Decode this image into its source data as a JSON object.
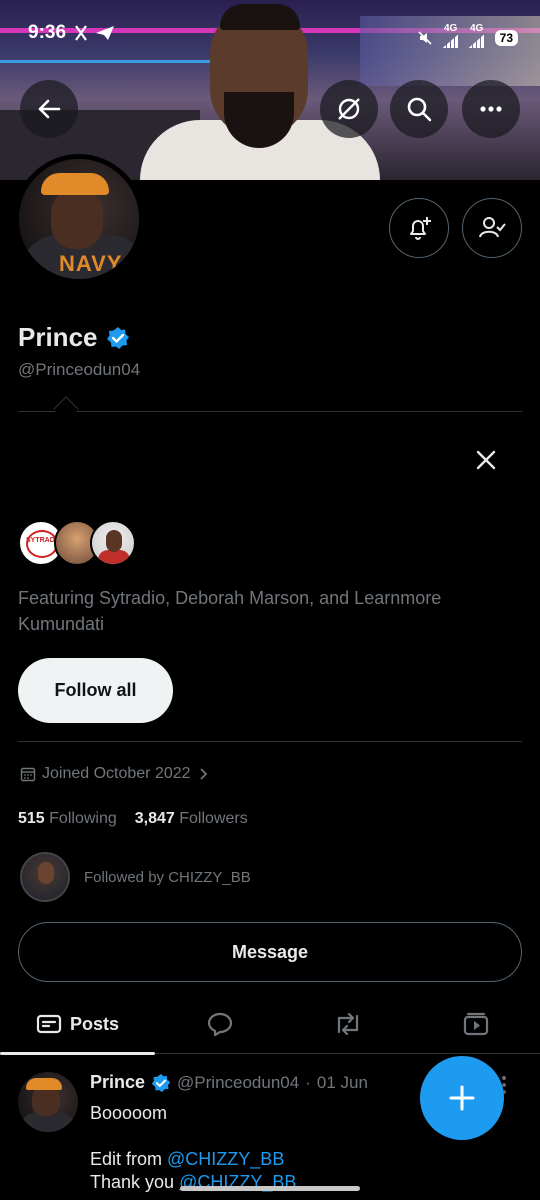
{
  "status_bar": {
    "time": "9:36",
    "network1": "4G",
    "network2": "4G",
    "battery": "73"
  },
  "banner_icons": {
    "back": "arrow-left-icon",
    "grok": "grok-icon",
    "search": "search-icon",
    "more": "more-horizontal-icon"
  },
  "profile": {
    "name": "Prince",
    "handle": "@Princeodun04",
    "joined": "Joined October 2022",
    "following_count": "515",
    "following_label": "Following",
    "followers_count": "3,847",
    "followers_label": "Followers",
    "followed_by": "Followed by CHIZZY_BB",
    "avatar_text": "NAVY"
  },
  "suggestions": {
    "featuring": "Featuring Sytradio, Deborah Marson, and Learnmore Kumundati",
    "follow_all_label": "Follow all",
    "logo_text": "SYTRADIO"
  },
  "actions": {
    "message_label": "Message"
  },
  "tabs": {
    "posts_label": "Posts"
  },
  "post": {
    "name": "Prince",
    "handle": "@Princeodun04",
    "separator": "·",
    "date": "01 Jun",
    "line1": "Booooom",
    "line2_prefix": "Edit from ",
    "line2_mention": "@CHIZZY_BB",
    "line3_prefix": "Thank you ",
    "line3_mention": "@CHIZZY_BB"
  },
  "colors": {
    "accent": "#1d9bf0",
    "background": "#000000",
    "text_primary": "#e7e9ea",
    "text_secondary": "#71767b",
    "border": "#2f3336"
  }
}
